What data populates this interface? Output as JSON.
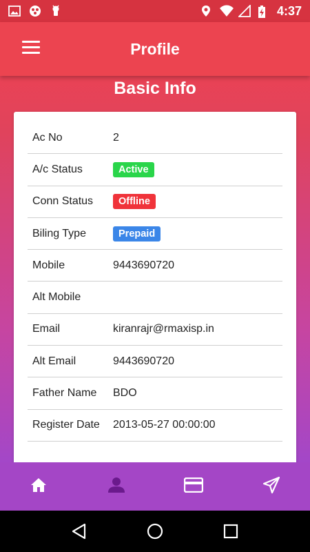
{
  "status_bar": {
    "time": "4:37",
    "icons_left": [
      "image-icon",
      "circles-icon",
      "android-icon"
    ],
    "icons_right": [
      "location-icon",
      "wifi-icon",
      "signal-icon",
      "battery-charging-icon"
    ]
  },
  "app_bar": {
    "title": "Profile",
    "menu_icon": "hamburger-menu-icon"
  },
  "section_title": "Basic Info",
  "rows": [
    {
      "label": "Ac No",
      "value": "2"
    },
    {
      "label": "A/c Status",
      "value": "Active",
      "badge_color": "#2ad54a"
    },
    {
      "label": "Conn Status",
      "value": "Offline",
      "badge_color": "#f0333a"
    },
    {
      "label": "Biling Type",
      "value": "Prepaid",
      "badge_color": "#3b86e8"
    },
    {
      "label": "Mobile",
      "value": "9443690720"
    },
    {
      "label": "Alt Mobile",
      "value": ""
    },
    {
      "label": "Email",
      "value": "kiranrajr@rmaxisp.in"
    },
    {
      "label": "Alt Email",
      "value": "9443690720"
    },
    {
      "label": "Father Name",
      "value": "BDO"
    },
    {
      "label": "Register Date",
      "value": "2013-05-27 00:00:00"
    }
  ],
  "bottom_nav": [
    {
      "icon": "home-icon",
      "active": false
    },
    {
      "icon": "person-icon",
      "active": true
    },
    {
      "icon": "credit-card-icon",
      "active": false
    },
    {
      "icon": "send-icon",
      "active": false
    }
  ],
  "system_nav": [
    "back-icon",
    "home-circle-icon",
    "recents-icon"
  ],
  "colors": {
    "primary": "#ec4450",
    "nav_bg": "#a446c6",
    "nav_active": "#6a1a8c"
  }
}
